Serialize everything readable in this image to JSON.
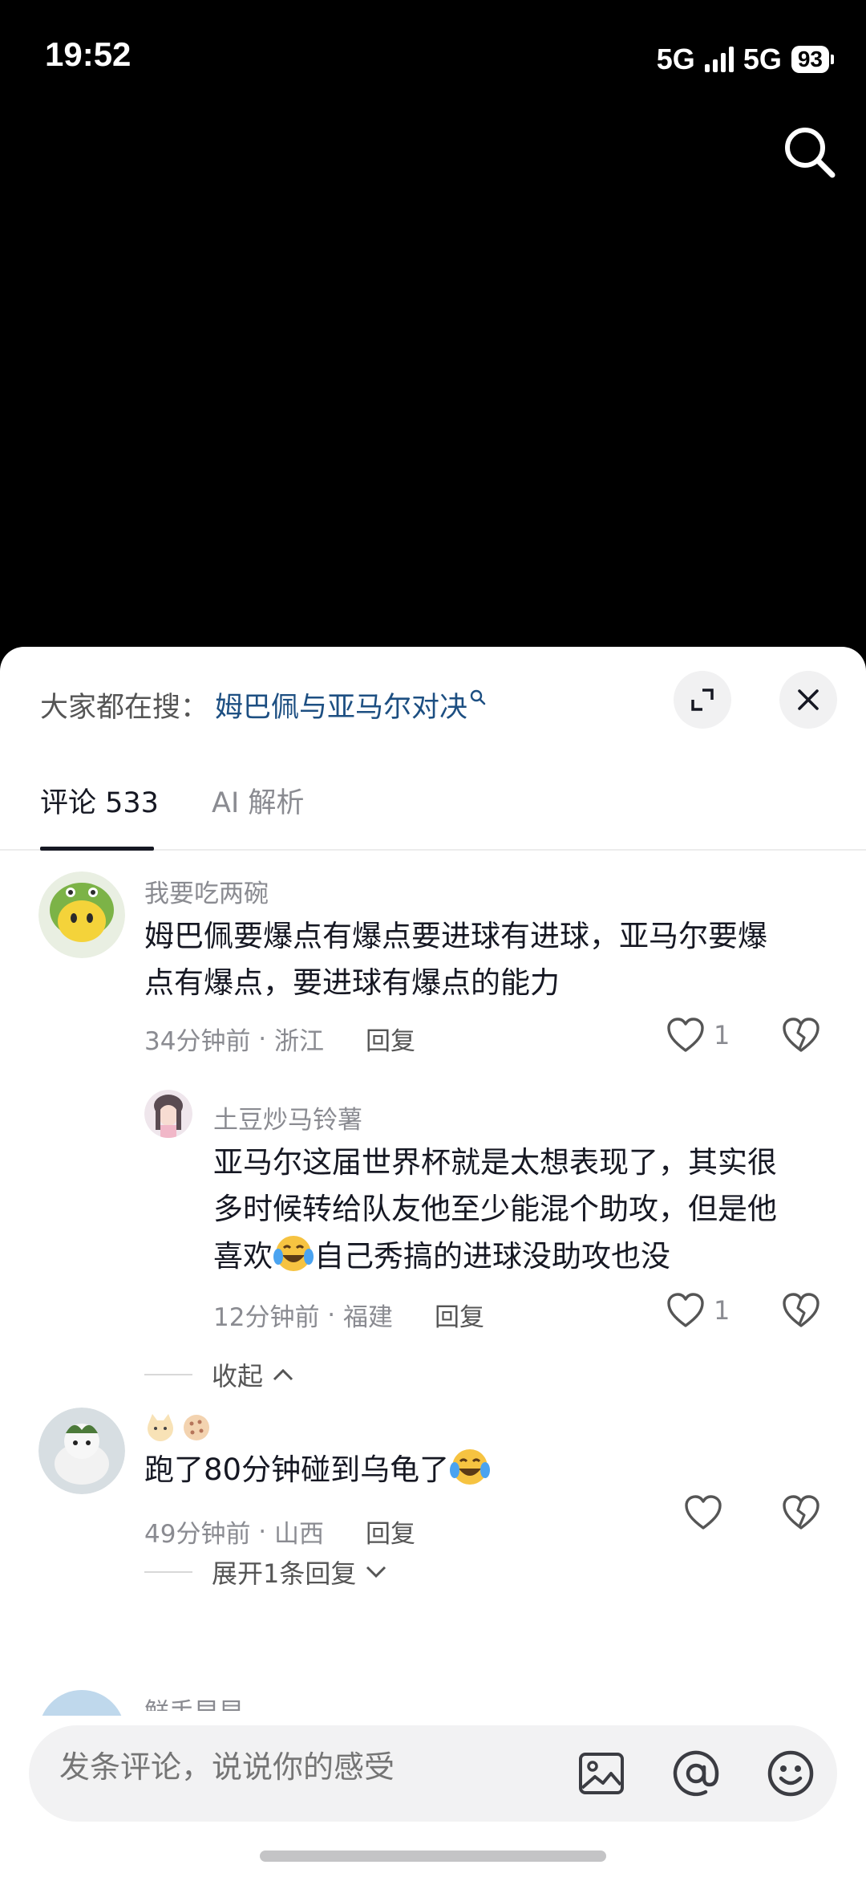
{
  "status_bar": {
    "time": "19:52",
    "network_1": "5G",
    "network_2": "5G",
    "battery": "93"
  },
  "hot_search": {
    "label": "大家都在搜：",
    "term": "姆巴佩与亚马尔对决"
  },
  "tabs": [
    {
      "label": "评论 533"
    },
    {
      "label": "AI 解析"
    }
  ],
  "comments": [
    {
      "user": "我要吃两碗",
      "text_lines": [
        "姆巴佩要爆点有爆点要进球有进球，亚马尔要爆",
        "点有爆点，要进球有爆点的能力"
      ],
      "time": "34分钟前",
      "location": "浙江",
      "reply_label": "回复",
      "likes": "1",
      "reply": {
        "user": "土豆炒马铃薯",
        "text_lines": [
          "亚马尔这届世界杯就是太想表现了，其实很",
          "多时候转给队友他至少能混个助攻，但是他",
          "喜欢",
          "自己秀搞的进球没助攻也没"
        ],
        "time": "12分钟前",
        "location": "福建",
        "reply_label": "回复",
        "likes": "1"
      },
      "collapse_label": "收起"
    },
    {
      "user": "",
      "text_before_emoji": "跑了80分钟碰到乌龟了",
      "time": "49分钟前",
      "location": "山西",
      "reply_label": "回复",
      "expand_label": "展开1条回复"
    }
  ],
  "partial_next_user": "鲜手早早",
  "composer": {
    "placeholder": "发条评论，说说你的感受"
  },
  "icons": {
    "search": "search-icon",
    "expand": "expand-icon",
    "close": "close-icon",
    "heart": "heart-icon",
    "dislike": "broken-heart-icon",
    "image": "image-icon",
    "mention": "at-icon",
    "emoji": "smiley-icon",
    "laugh_cry": "laugh-cry-emoji"
  },
  "colors": {
    "accent_link": "#1d4f82",
    "text_primary": "#161823",
    "text_secondary": "#8a8b91"
  }
}
